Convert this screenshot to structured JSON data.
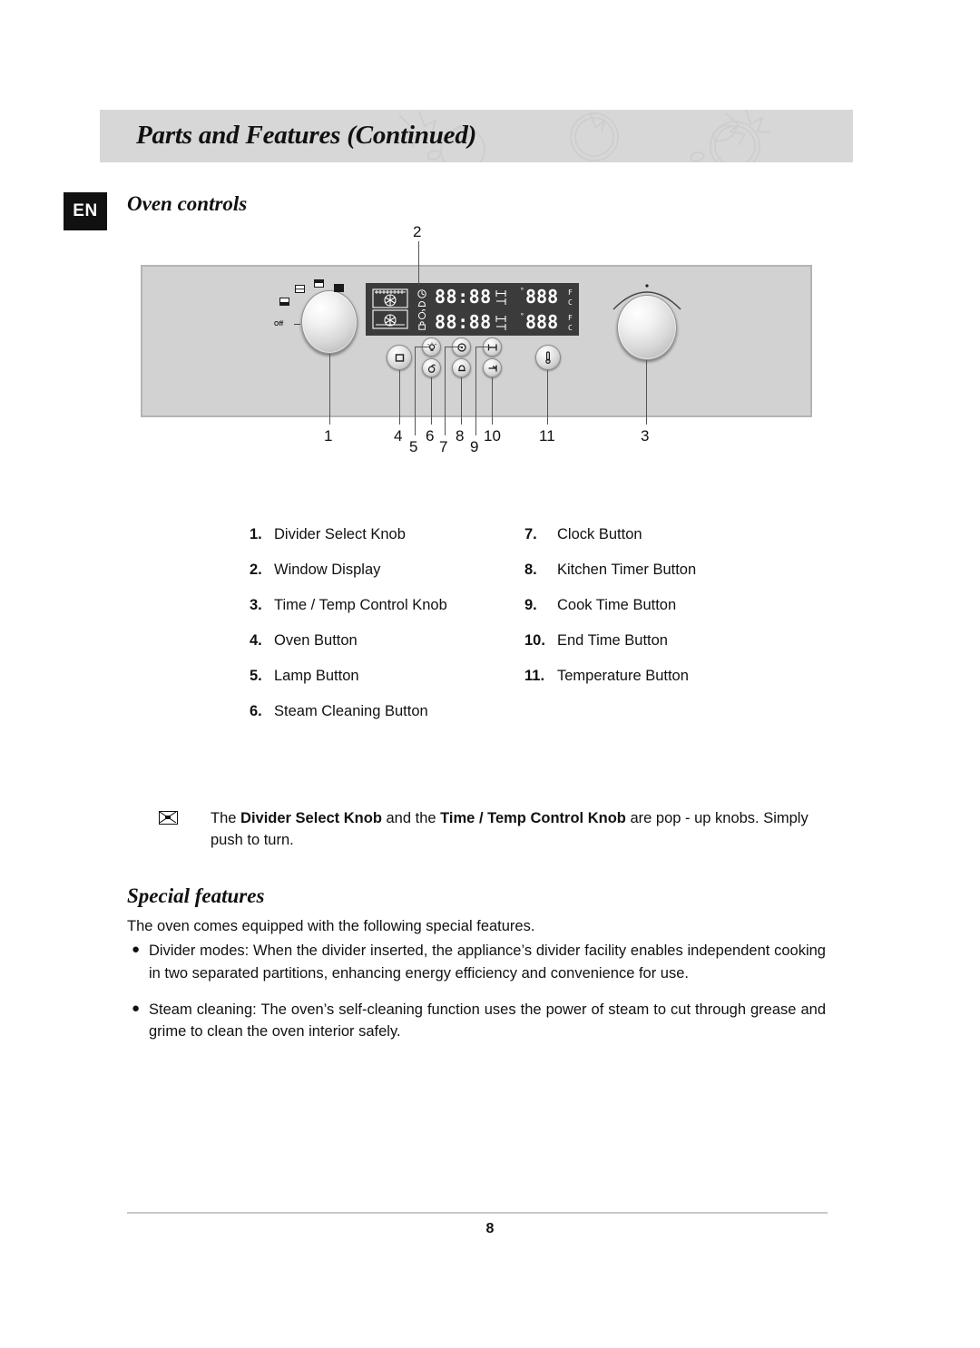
{
  "header": {
    "title": "Parts and Features (Continued)",
    "band_color": "#d7d7d7"
  },
  "language_badge": "EN",
  "sections": {
    "oven_controls_title": "Oven controls",
    "special_features_title": "Special features"
  },
  "diagram": {
    "panel_color": "#d2d2d2",
    "lcd_color": "#3b3b3b",
    "knob_off_label": "Off",
    "lcd": {
      "time_upper": "88:88",
      "time_lower": "88:88",
      "temp_upper": "888",
      "temp_lower": "888",
      "unit_f": "F",
      "unit_c": "C"
    },
    "callouts": [
      {
        "number": "2",
        "name": "window-display"
      },
      {
        "number": "1",
        "name": "divider-select-knob"
      },
      {
        "number": "4",
        "name": "oven-button"
      },
      {
        "number": "5",
        "name": "lamp-button"
      },
      {
        "number": "6",
        "name": "steam-cleaning-button"
      },
      {
        "number": "7",
        "name": "clock-button"
      },
      {
        "number": "8",
        "name": "kitchen-timer-button"
      },
      {
        "number": "9",
        "name": "cook-time-button"
      },
      {
        "number": "10",
        "name": "end-time-button"
      },
      {
        "number": "11",
        "name": "temperature-button"
      },
      {
        "number": "3",
        "name": "time-temp-control-knob"
      }
    ]
  },
  "parts_list": {
    "left": [
      {
        "num": "1.",
        "label": "Divider Select Knob"
      },
      {
        "num": "2.",
        "label": "Window Display"
      },
      {
        "num": "3.",
        "label": "Time / Temp Control Knob"
      },
      {
        "num": "4.",
        "label": "Oven Button"
      },
      {
        "num": "5.",
        "label": "Lamp Button"
      },
      {
        "num": "6.",
        "label": "Steam Cleaning Button"
      }
    ],
    "right": [
      {
        "num": "7.",
        "label": "Clock Button"
      },
      {
        "num": "8.",
        "label": "Kitchen Timer Button"
      },
      {
        "num": "9.",
        "label": "Cook Time Button"
      },
      {
        "num": "10.",
        "label": "End Time Button"
      },
      {
        "num": "11.",
        "label": "Temperature Button"
      }
    ]
  },
  "note": {
    "part1": "The ",
    "bold1": "Divider Select Knob",
    "part2": " and the ",
    "bold2": "Time / Temp Control Knob",
    "part3": " are pop - up knobs. Simply push to turn."
  },
  "special_features": {
    "intro": "The oven comes equipped with the following special features.",
    "bullet_glyph": "●",
    "items": [
      "Divider modes: When the divider inserted, the appliance’s divider facility enables independent cooking in two separated partitions, enhancing energy efficiency and convenience for use.",
      "Steam cleaning: The oven’s self-cleaning function uses the power of steam to cut through grease and grime to clean the oven interior safely."
    ]
  },
  "footer": {
    "page_number": "8"
  }
}
